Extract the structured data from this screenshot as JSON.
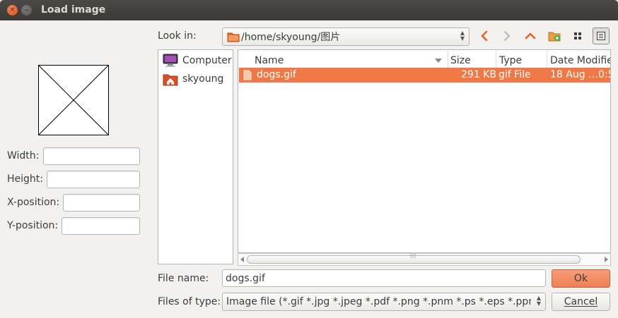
{
  "window": {
    "title": "Load image"
  },
  "preview_panel": {
    "width_label": "Width:",
    "height_label": "Height:",
    "xpos_label": "X-position:",
    "ypos_label": "Y-position:"
  },
  "location": {
    "label": "Look in:",
    "path": "/home/skyoung/图片"
  },
  "places": [
    {
      "label": "Computer",
      "icon": "computer-icon"
    },
    {
      "label": "skyoung",
      "icon": "home-folder-icon"
    }
  ],
  "file_list": {
    "columns": [
      "Name",
      "Size",
      "Type",
      "Date Modified"
    ],
    "rows": [
      {
        "name": "dogs.gif",
        "size": "291 KB",
        "type": "gif File",
        "date": "18 Aug …0:5"
      }
    ]
  },
  "file_name": {
    "label": "File name:",
    "value": "dogs.gif"
  },
  "file_type": {
    "label": "Files of type:",
    "selected": "Image file (*.gif *.jpg *.jpeg *.pdf *.png *.pnm *.ps *.eps *.ppm *.s"
  },
  "buttons": {
    "ok": "Ok",
    "cancel": "Cancel"
  },
  "colors": {
    "accent": "#f07746",
    "titlebar": "#3c3b37",
    "background": "#f2f1f0"
  }
}
